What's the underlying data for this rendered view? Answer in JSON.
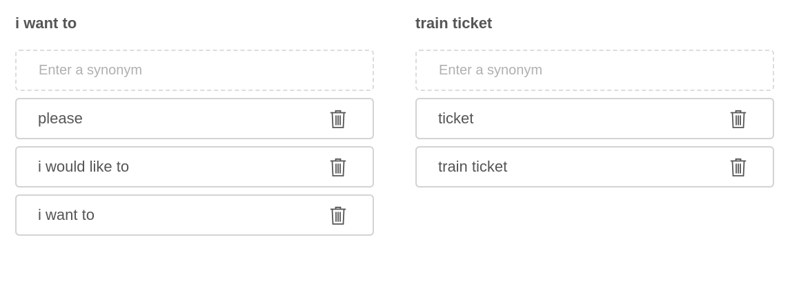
{
  "groups": [
    {
      "title": "i want to",
      "input": {
        "value": "",
        "placeholder": "Enter a synonym"
      },
      "synonyms": [
        "please",
        "i would like to",
        "i want to"
      ]
    },
    {
      "title": "train ticket",
      "input": {
        "value": "",
        "placeholder": "Enter a synonym"
      },
      "synonyms": [
        "ticket",
        "train ticket"
      ]
    }
  ],
  "icons": {
    "delete": "trash-icon"
  },
  "colors": {
    "text": "#555555",
    "placeholder": "#b0b0b0",
    "border": "#d3d3d3",
    "dashed_border": "#dcdcdc"
  }
}
